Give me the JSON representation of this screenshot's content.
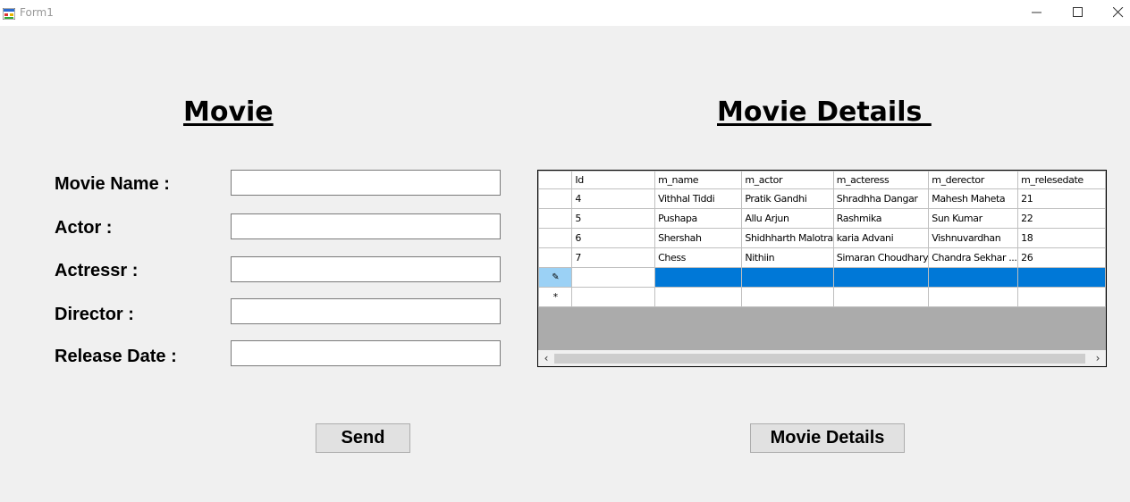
{
  "window": {
    "title": "Form1"
  },
  "left": {
    "heading": "Movie",
    "fields": [
      {
        "label": "Movie Name :",
        "value": ""
      },
      {
        "label": "Actor :",
        "value": ""
      },
      {
        "label": "Actressr :",
        "value": ""
      },
      {
        "label": "Director :",
        "value": ""
      },
      {
        "label": "Release Date :",
        "value": ""
      }
    ],
    "send_label": "Send"
  },
  "right": {
    "heading": "Movie Details ",
    "details_button_label": "Movie Details",
    "grid": {
      "columns": [
        "Id",
        "m_name",
        "m_actor",
        "m_acteress",
        "m_derector",
        "m_relesedate"
      ],
      "rows": [
        [
          "4",
          "Vithhal Tiddi",
          "Pratik Gandhi",
          "Shradhha Dangar",
          "Mahesh Maheta",
          "21"
        ],
        [
          "5",
          "Pushapa",
          "Allu Arjun",
          "Rashmika",
          "Sun Kumar",
          "22"
        ],
        [
          "6",
          "Shershah",
          "Shidhharth Malotra",
          "karia Advani",
          " Vishnuvardhan",
          "18"
        ],
        [
          "7",
          "Chess",
          "Nithiin",
          "Simaran Choudhary",
          "Chandra Sekhar ...",
          "26"
        ]
      ],
      "edit_row_marker": "✎",
      "new_row_marker": "*",
      "selection_color": "#0078d7"
    }
  }
}
